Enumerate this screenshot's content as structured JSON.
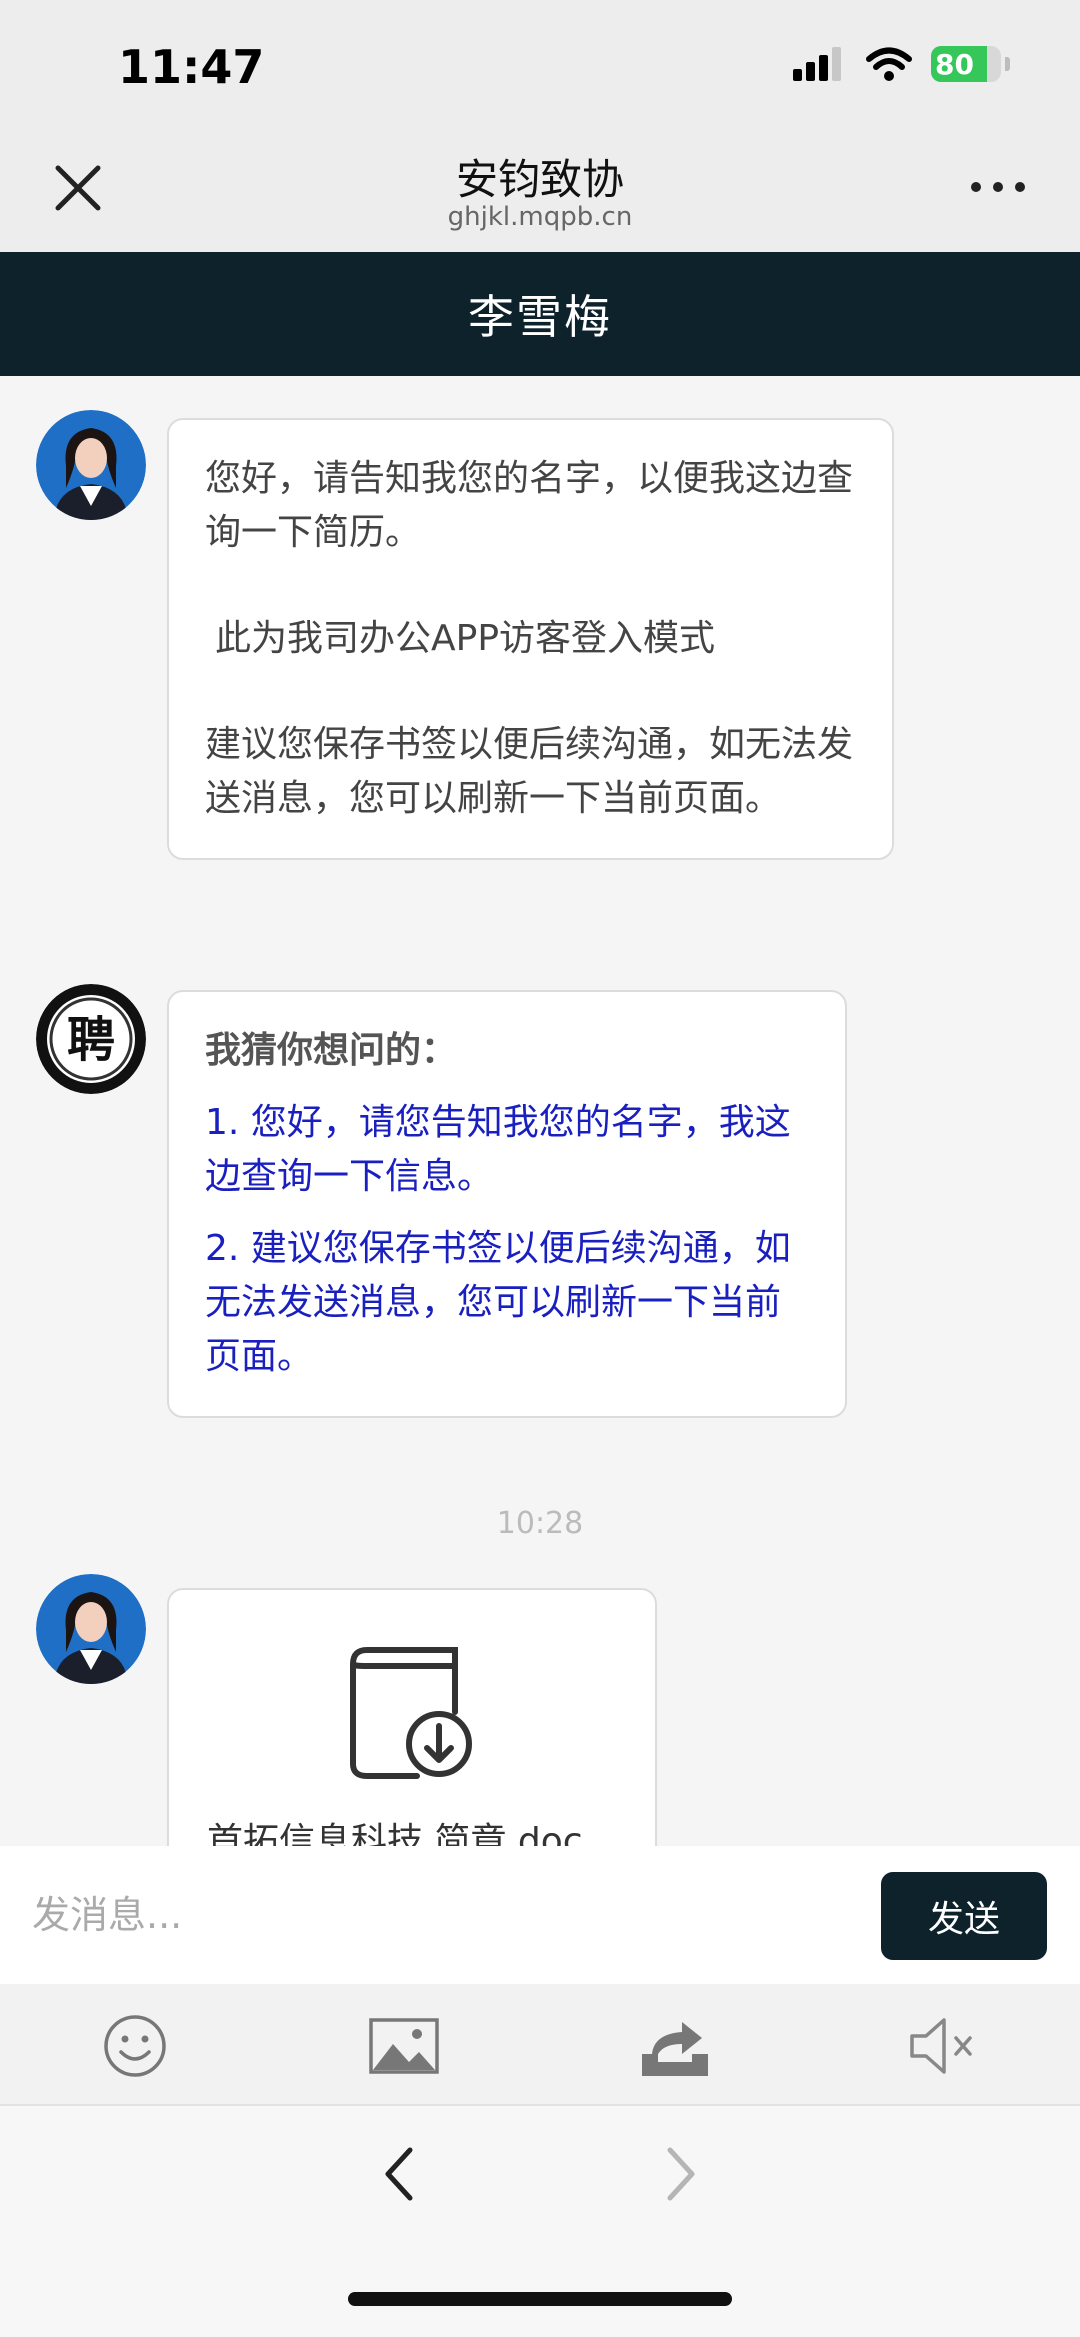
{
  "status_bar": {
    "time": "11:47",
    "battery": "80",
    "battery_level": 0.8
  },
  "header": {
    "title": "安钧致协",
    "url": "ghjkl.mqpb.cn"
  },
  "contact": {
    "name": "李雪梅"
  },
  "messages": {
    "m1": {
      "p1": "您好，请告知我您的名字，以便我这边查询一下简历。",
      "p2": "此为我司办公APP访客登入模式",
      "p3": "建议您保存书签以便后续沟通，如无法发送消息，您可以刷新一下当前页面。"
    },
    "suggest": {
      "heading": "我猜你想问的：",
      "items": [
        "1. 您好，请您告知我您的名字，我这边查询一下信息。",
        "2. 建议您保存书签以便后续沟通，如无法发送消息，您可以刷新一下当前页面。"
      ]
    },
    "timestamp": "10:28",
    "file": {
      "name": "首拓信息科技 简章.doc"
    }
  },
  "composer": {
    "placeholder": "发消息...",
    "send_label": "发送"
  },
  "icons": {
    "close": "close-icon",
    "more": "more-icon",
    "emoji": "emoji-icon",
    "image": "image-icon",
    "share": "share-icon",
    "mute": "mute-icon",
    "file": "file-download-icon"
  },
  "colors": {
    "accent": "#0e222c",
    "link": "#1a1fbf",
    "battery": "#35c759"
  }
}
